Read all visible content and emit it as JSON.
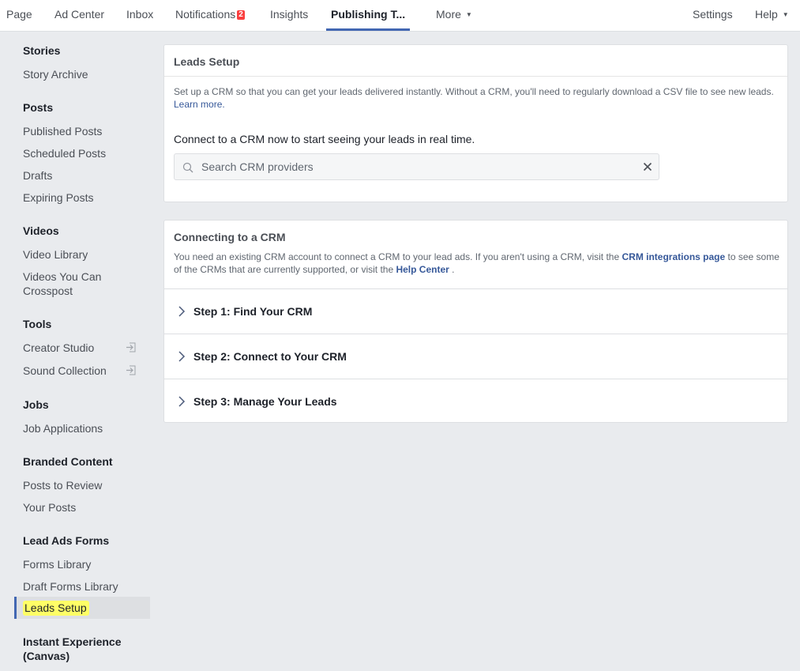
{
  "topnav": {
    "tabs": [
      {
        "label": "Page"
      },
      {
        "label": "Ad Center"
      },
      {
        "label": "Inbox"
      },
      {
        "label": "Notifications",
        "badge": "2"
      },
      {
        "label": "Insights"
      },
      {
        "label": "Publishing T..."
      },
      {
        "label": "More"
      }
    ],
    "active_tab": "Publishing T...",
    "right": [
      {
        "label": "Settings"
      },
      {
        "label": "Help"
      }
    ]
  },
  "sidebar": {
    "sections": [
      {
        "heading": "Stories",
        "items": [
          "Story Archive"
        ]
      },
      {
        "heading": "Posts",
        "items": [
          "Published Posts",
          "Scheduled Posts",
          "Drafts",
          "Expiring Posts"
        ]
      },
      {
        "heading": "Videos",
        "items": [
          "Video Library",
          "Videos You Can Crosspost"
        ]
      },
      {
        "heading": "Tools",
        "items": [
          "Creator Studio",
          "Sound Collection"
        ]
      },
      {
        "heading": "Jobs",
        "items": [
          "Job Applications"
        ]
      },
      {
        "heading": "Branded Content",
        "items": [
          "Posts to Review",
          "Your Posts"
        ]
      },
      {
        "heading": "Lead Ads Forms",
        "items": [
          "Forms Library",
          "Draft Forms Library",
          "Leads Setup"
        ]
      },
      {
        "heading": "Instant Experience (Canvas)",
        "items": []
      }
    ],
    "selected": "Leads Setup",
    "highlight_color": "#ffff66",
    "accent_color": "#4267b2"
  },
  "leads_setup": {
    "title": "Leads Setup",
    "description": "Set up a CRM so that you can get your leads delivered instantly. Without a CRM, you'll need to regularly download a CSV file to see new leads.",
    "learn_more": "Learn more.",
    "connect_prompt": "Connect to a CRM now to start seeing your leads in real time.",
    "search_placeholder": "Search CRM providers",
    "search_value": ""
  },
  "connecting": {
    "title": "Connecting to a CRM",
    "desc_part1": "You need an existing CRM account to connect a CRM to your lead ads. If you aren't using a CRM, visit the ",
    "crm_link": "CRM integrations page",
    "desc_part2": " to see some of the CRMs that are currently supported, or visit the ",
    "help_link": "Help Center",
    "desc_part3": " .",
    "steps": [
      {
        "label": "Step 1: Find Your CRM"
      },
      {
        "label": "Step 2: Connect to Your CRM"
      },
      {
        "label": "Step 3: Manage Your Leads"
      }
    ]
  },
  "icons": {
    "external": "arrow-into-box-icon",
    "search": "magnifier-icon",
    "clear": "x-icon",
    "step": "chevron-right-icon",
    "dropdown": "caret-down-icon"
  }
}
